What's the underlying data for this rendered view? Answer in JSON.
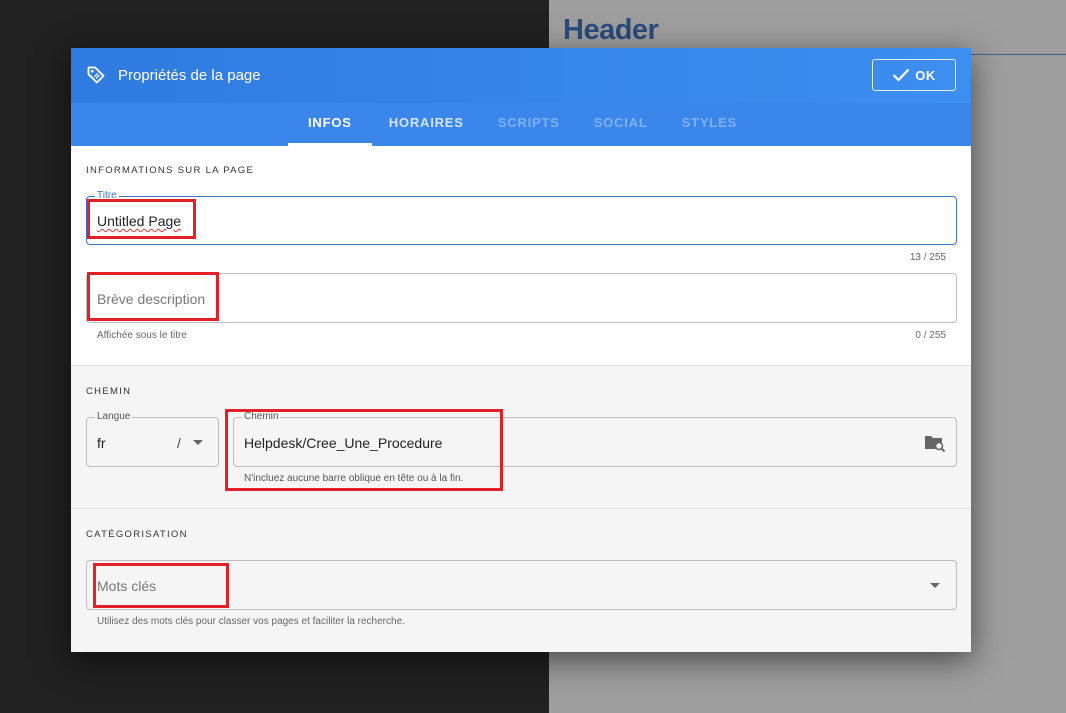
{
  "background": {
    "header_text": "Header"
  },
  "dialog": {
    "title": "Propriétés de la page",
    "ok_label": "OK",
    "tabs": [
      {
        "label": "INFOS",
        "state": "active"
      },
      {
        "label": "HORAIRES",
        "state": "enabled"
      },
      {
        "label": "SCRIPTS",
        "state": "disabled"
      },
      {
        "label": "SOCIAL",
        "state": "disabled"
      },
      {
        "label": "STYLES",
        "state": "disabled"
      }
    ]
  },
  "info": {
    "section_label": "INFORMATIONS SUR LA PAGE",
    "title_legend": "Titre",
    "title_value": "Untitled Page",
    "title_counter": "13 / 255",
    "description_placeholder": "Brève description",
    "description_hint": "Affichée sous le titre",
    "description_counter": "0 / 255"
  },
  "path": {
    "section_label": "CHEMIN",
    "language_legend": "Langue",
    "language_value": "fr",
    "separator": "/",
    "path_legend": "Chemin",
    "path_value": "Helpdesk/Cree_Une_Procedure",
    "path_hint": "N'incluez aucune barre oblique en tête ou à la fin."
  },
  "categorization": {
    "section_label": "CATÉGORISATION",
    "tags_placeholder": "Mots clés",
    "tags_hint": "Utilisez des mots clés pour classer vos pages et faciliter la recherche."
  },
  "colors": {
    "toolbar": "#2f7be0",
    "tabs_bar": "#3a86ea",
    "annotation_red": "#e32028",
    "focus_blue": "#3f6fc7"
  }
}
